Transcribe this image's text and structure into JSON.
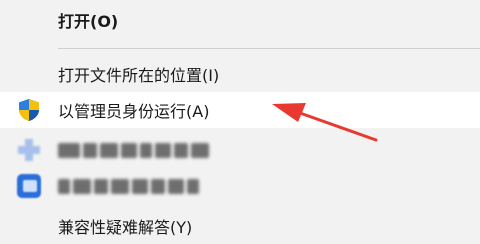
{
  "menu": {
    "items": [
      {
        "label": "打开(O)"
      },
      {
        "label": "打开文件所在的位置(I)"
      },
      {
        "label": "以管理员身份运行(A)",
        "icon": "uac-shield-icon"
      },
      {
        "label": "",
        "icon": "app-icon-blurred"
      },
      {
        "label": "",
        "icon": "app-icon-blurred"
      },
      {
        "label": "兼容性疑难解答(Y)"
      }
    ]
  },
  "colors": {
    "menu_background": "#f2f2f2",
    "hover_background": "#ffffff",
    "arrow": "#e8382f",
    "shield_blue": "#1e6fd0",
    "shield_yellow": "#f4c20d"
  }
}
